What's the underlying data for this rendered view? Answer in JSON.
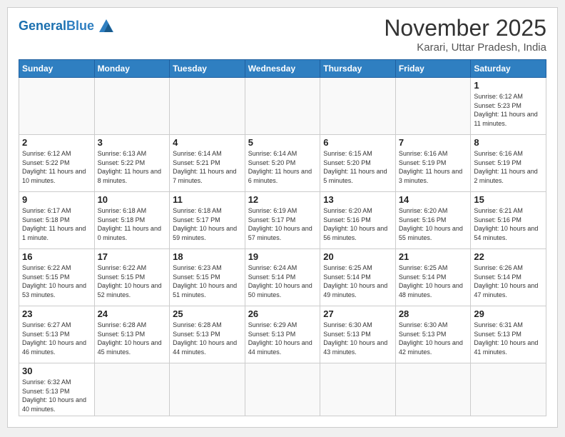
{
  "header": {
    "logo_general": "General",
    "logo_blue": "Blue",
    "month_year": "November 2025",
    "location": "Karari, Uttar Pradesh, India"
  },
  "weekdays": [
    "Sunday",
    "Monday",
    "Tuesday",
    "Wednesday",
    "Thursday",
    "Friday",
    "Saturday"
  ],
  "days": {
    "1": {
      "sunrise": "6:12 AM",
      "sunset": "5:23 PM",
      "daylight": "11 hours and 11 minutes."
    },
    "2": {
      "sunrise": "6:12 AM",
      "sunset": "5:22 PM",
      "daylight": "11 hours and 10 minutes."
    },
    "3": {
      "sunrise": "6:13 AM",
      "sunset": "5:22 PM",
      "daylight": "11 hours and 8 minutes."
    },
    "4": {
      "sunrise": "6:14 AM",
      "sunset": "5:21 PM",
      "daylight": "11 hours and 7 minutes."
    },
    "5": {
      "sunrise": "6:14 AM",
      "sunset": "5:20 PM",
      "daylight": "11 hours and 6 minutes."
    },
    "6": {
      "sunrise": "6:15 AM",
      "sunset": "5:20 PM",
      "daylight": "11 hours and 5 minutes."
    },
    "7": {
      "sunrise": "6:16 AM",
      "sunset": "5:19 PM",
      "daylight": "11 hours and 3 minutes."
    },
    "8": {
      "sunrise": "6:16 AM",
      "sunset": "5:19 PM",
      "daylight": "11 hours and 2 minutes."
    },
    "9": {
      "sunrise": "6:17 AM",
      "sunset": "5:18 PM",
      "daylight": "11 hours and 1 minute."
    },
    "10": {
      "sunrise": "6:18 AM",
      "sunset": "5:18 PM",
      "daylight": "11 hours and 0 minutes."
    },
    "11": {
      "sunrise": "6:18 AM",
      "sunset": "5:17 PM",
      "daylight": "10 hours and 59 minutes."
    },
    "12": {
      "sunrise": "6:19 AM",
      "sunset": "5:17 PM",
      "daylight": "10 hours and 57 minutes."
    },
    "13": {
      "sunrise": "6:20 AM",
      "sunset": "5:16 PM",
      "daylight": "10 hours and 56 minutes."
    },
    "14": {
      "sunrise": "6:20 AM",
      "sunset": "5:16 PM",
      "daylight": "10 hours and 55 minutes."
    },
    "15": {
      "sunrise": "6:21 AM",
      "sunset": "5:16 PM",
      "daylight": "10 hours and 54 minutes."
    },
    "16": {
      "sunrise": "6:22 AM",
      "sunset": "5:15 PM",
      "daylight": "10 hours and 53 minutes."
    },
    "17": {
      "sunrise": "6:22 AM",
      "sunset": "5:15 PM",
      "daylight": "10 hours and 52 minutes."
    },
    "18": {
      "sunrise": "6:23 AM",
      "sunset": "5:15 PM",
      "daylight": "10 hours and 51 minutes."
    },
    "19": {
      "sunrise": "6:24 AM",
      "sunset": "5:14 PM",
      "daylight": "10 hours and 50 minutes."
    },
    "20": {
      "sunrise": "6:25 AM",
      "sunset": "5:14 PM",
      "daylight": "10 hours and 49 minutes."
    },
    "21": {
      "sunrise": "6:25 AM",
      "sunset": "5:14 PM",
      "daylight": "10 hours and 48 minutes."
    },
    "22": {
      "sunrise": "6:26 AM",
      "sunset": "5:14 PM",
      "daylight": "10 hours and 47 minutes."
    },
    "23": {
      "sunrise": "6:27 AM",
      "sunset": "5:13 PM",
      "daylight": "10 hours and 46 minutes."
    },
    "24": {
      "sunrise": "6:28 AM",
      "sunset": "5:13 PM",
      "daylight": "10 hours and 45 minutes."
    },
    "25": {
      "sunrise": "6:28 AM",
      "sunset": "5:13 PM",
      "daylight": "10 hours and 44 minutes."
    },
    "26": {
      "sunrise": "6:29 AM",
      "sunset": "5:13 PM",
      "daylight": "10 hours and 44 minutes."
    },
    "27": {
      "sunrise": "6:30 AM",
      "sunset": "5:13 PM",
      "daylight": "10 hours and 43 minutes."
    },
    "28": {
      "sunrise": "6:30 AM",
      "sunset": "5:13 PM",
      "daylight": "10 hours and 42 minutes."
    },
    "29": {
      "sunrise": "6:31 AM",
      "sunset": "5:13 PM",
      "daylight": "10 hours and 41 minutes."
    },
    "30": {
      "sunrise": "6:32 AM",
      "sunset": "5:13 PM",
      "daylight": "10 hours and 40 minutes."
    }
  }
}
